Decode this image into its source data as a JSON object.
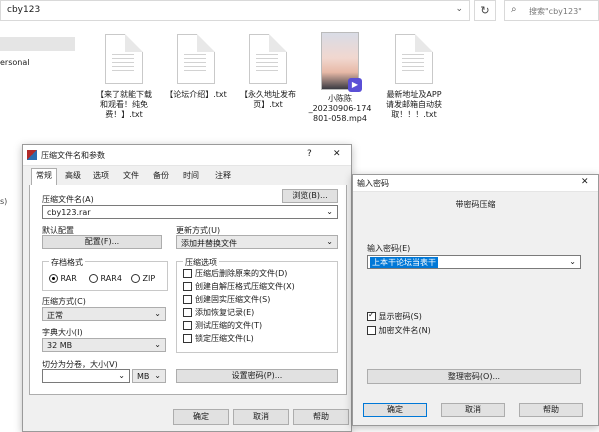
{
  "explorer": {
    "path": "cby123",
    "search_placeholder": "搜索\"cby123\"",
    "nav_item": "ersonal",
    "nav_fragment": "s)",
    "files": [
      {
        "name_lines": [
          "【来了就能下载",
          "和观看！纯免",
          "费！】.txt"
        ],
        "kind": "doc"
      },
      {
        "name_lines": [
          "【论坛介绍】.txt"
        ],
        "kind": "doc"
      },
      {
        "name_lines": [
          "【永久地址发布",
          "页】.txt"
        ],
        "kind": "doc"
      },
      {
        "name_lines": [
          "小陈陈",
          "_20230906-174",
          "801-058.mp4"
        ],
        "kind": "video"
      },
      {
        "name_lines": [
          "最新地址及APP",
          "请发邮箱自动获",
          "取！！！.txt"
        ],
        "kind": "doc"
      }
    ]
  },
  "archive_dialog": {
    "title": "压缩文件名和参数",
    "help_glyph": "?",
    "close_glyph": "✕",
    "tabs": [
      "常规",
      "高级",
      "选项",
      "文件",
      "备份",
      "时间",
      "注释"
    ],
    "active_tab": 0,
    "archive_name_label": "压缩文件名(A)",
    "browse_button": "浏览(B)...",
    "archive_name_value": "cby123.rar",
    "default_profile_label": "默认配置",
    "profile_button": "配置(F)...",
    "update_mode_label": "更新方式(U)",
    "update_mode_value": "添加并替换文件",
    "format_group_label": "存档格式",
    "formats": [
      {
        "label": "RAR",
        "selected": true
      },
      {
        "label": "RAR4",
        "selected": false
      },
      {
        "label": "ZIP",
        "selected": false
      }
    ],
    "options_group_label": "压缩选项",
    "options": [
      {
        "label": "压缩后删除原来的文件(D)",
        "checked": false
      },
      {
        "label": "创建自解压格式压缩文件(X)",
        "checked": false
      },
      {
        "label": "创建固实压缩文件(S)",
        "checked": false
      },
      {
        "label": "添加恢复记录(E)",
        "checked": false
      },
      {
        "label": "测试压缩的文件(T)",
        "checked": false
      },
      {
        "label": "锁定压缩文件(L)",
        "checked": false
      }
    ],
    "method_label": "压缩方式(C)",
    "method_value": "正常",
    "dict_label": "字典大小(I)",
    "dict_value": "32 MB",
    "split_label": "切分为分卷，大小(V)",
    "split_value": "",
    "split_unit": "MB",
    "set_password_button": "设置密码(P)...",
    "ok_button": "确定",
    "cancel_button": "取消",
    "help_button": "帮助"
  },
  "password_dialog": {
    "title": "输入密码",
    "close_glyph": "✕",
    "heading": "带密码压缩",
    "password_label": "输入密码(E)",
    "password_value": "上本干论坛当表干",
    "show_password_label": "显示密码(S)",
    "show_password_checked": true,
    "encrypt_names_label": "加密文件名(N)",
    "encrypt_names_checked": false,
    "organize_button": "整理密码(O)...",
    "ok_button": "确定",
    "cancel_button": "取消",
    "help_button": "帮助"
  },
  "colors": {
    "selection_blue": "#0078d7",
    "dialog_bg": "#f0f0f0"
  }
}
